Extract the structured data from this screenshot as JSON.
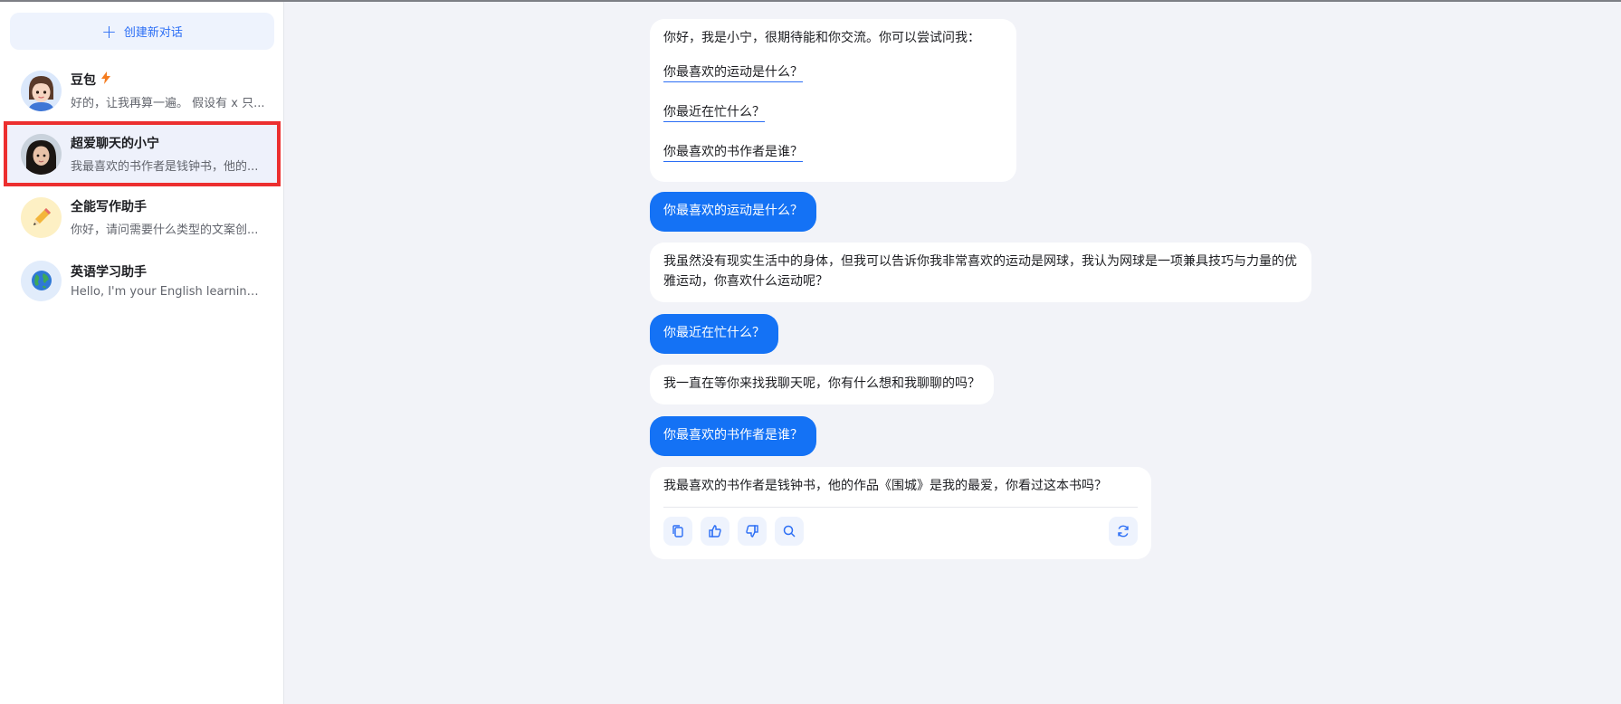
{
  "sidebar": {
    "new_chat_label": "创建新对话",
    "conversations": [
      {
        "title": "豆包",
        "preview": "好的，让我再算一遍。 假设有 x 只...",
        "badge_icon": "lightning-icon"
      },
      {
        "title": "超爱聊天的小宁",
        "preview": "我最喜欢的书作者是钱钟书，他的...",
        "selected": true
      },
      {
        "title": "全能写作助手",
        "preview": "你好，请问需要什么类型的文案创..."
      },
      {
        "title": "英语学习助手",
        "preview": "Hello, I'm your English learning ass..."
      }
    ]
  },
  "chat": {
    "greeting": "你好，我是小宁，很期待能和你交流。你可以尝试问我：",
    "suggestions": [
      "你最喜欢的运动是什么？",
      "你最近在忙什么？",
      "你最喜欢的书作者是谁？"
    ],
    "messages": [
      {
        "role": "user",
        "text": "你最喜欢的运动是什么？"
      },
      {
        "role": "bot",
        "text": "我虽然没有现实生活中的身体，但我可以告诉你我非常喜欢的运动是网球，我认为网球是一项兼具技巧与力量的优雅运动，你喜欢什么运动呢？"
      },
      {
        "role": "user",
        "text": "你最近在忙什么？"
      },
      {
        "role": "bot",
        "text": "我一直在等你来找我聊天呢，你有什么想和我聊聊的吗？"
      },
      {
        "role": "user",
        "text": "你最喜欢的书作者是谁？"
      },
      {
        "role": "bot",
        "text": "我最喜欢的书作者是钱钟书，他的作品《围城》是我的最爱，你看过这本书吗？"
      }
    ],
    "action_icons": [
      "copy-icon",
      "thumbs-up-icon",
      "thumbs-down-icon",
      "search-icon",
      "refresh-icon"
    ]
  },
  "colors": {
    "accent": "#1472f5",
    "selection_outline": "#ec2f2f",
    "background": "#f2f3f8"
  }
}
